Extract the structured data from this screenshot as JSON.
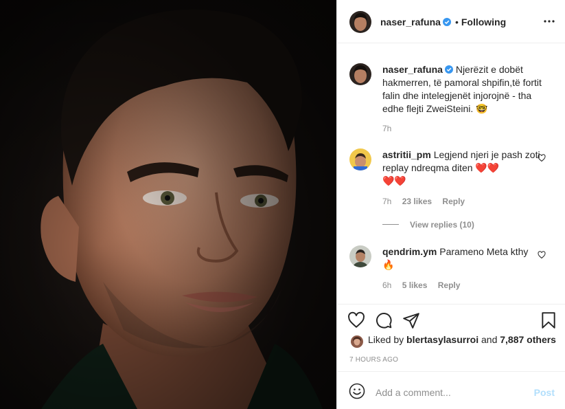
{
  "post": {
    "username": "naser_rafuna",
    "separator": "•",
    "follow_state": "Following"
  },
  "caption": {
    "username": "naser_rafuna",
    "text": "Njerëzit e dobët hakmerren, të pamoral shpifin,të fortit falin dhe intelegjenët injorojnë - tha edhe flejti ZweiSteini.",
    "emoji": "🤓",
    "time": "7h"
  },
  "comments": [
    {
      "username": "astritii_pm",
      "text": "Legjend njeri je pash zoti replay ndreqma diten",
      "emoji_line1": "❤️❤️",
      "emoji_line2": "❤️❤️",
      "time": "7h",
      "likes": "23 likes",
      "reply": "Reply",
      "view_replies": "View replies (10)"
    },
    {
      "username": "qendrim.ym",
      "text": "Parameno Meta kthy",
      "emoji_line2": "🔥",
      "time": "6h",
      "likes": "5 likes",
      "reply": "Reply"
    }
  ],
  "likes": {
    "prefix": "Liked by",
    "user": "blertasylasurroi",
    "conj": "and",
    "others": "7,887 others"
  },
  "timestamp": "7 HOURS AGO",
  "add_comment": {
    "placeholder": "Add a comment...",
    "post_label": "Post"
  },
  "icons": {
    "verified": "verified-badge-icon",
    "more": "more-options-icon",
    "heart": "heart-icon",
    "comment": "comment-icon",
    "share": "share-icon",
    "save": "bookmark-icon",
    "emoji": "emoji-icon"
  },
  "colors": {
    "verified_blue": "#3897f0",
    "muted": "#8e8e8e",
    "post_disabled": "#b2dffc"
  }
}
